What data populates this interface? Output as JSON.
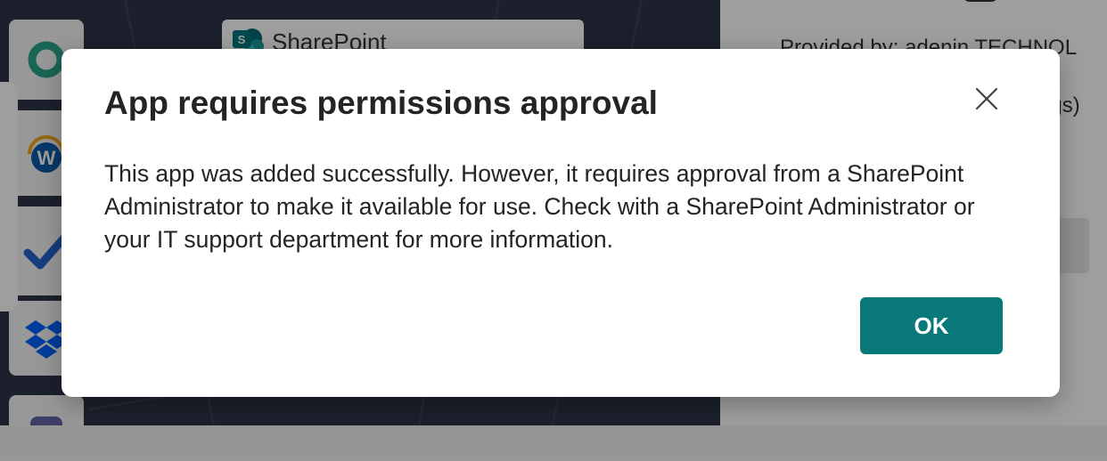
{
  "background": {
    "sharepoint_card": {
      "label": "SharePoint"
    },
    "details": {
      "provided_by": "Provided by: adenin TECHNOL",
      "fragment": "ngs)"
    },
    "tiles": [
      {
        "icon": "ring-app-icon"
      },
      {
        "icon": "workday-w-icon"
      },
      {
        "icon": "checkmark-app-icon"
      },
      {
        "icon": "dropbox-icon"
      },
      {
        "icon": "purple-app-icon"
      }
    ]
  },
  "dialog": {
    "title": "App requires permissions approval",
    "body": "This app was added successfully. However, it requires approval from a SharePoint Administrator to make it available for use. Check with a SharePoint Administrator or your IT support department for more information.",
    "ok_label": "OK",
    "close_icon": "close-icon"
  },
  "colors": {
    "primary_button": "#087878",
    "dialog_background": "#ffffff",
    "text": "#242424"
  }
}
